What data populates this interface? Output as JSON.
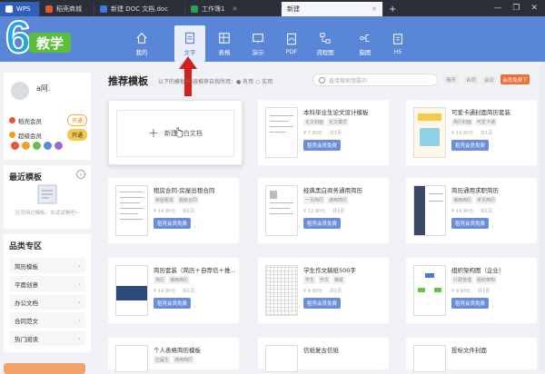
{
  "tabs": [
    {
      "label": "WPS",
      "color": "#2b6fd6"
    },
    {
      "label": "稻壳商城",
      "color": "#e8562f"
    },
    {
      "label": "新建 DOC 文档.doc",
      "color": "#3b7be0"
    },
    {
      "label": "工作簿1",
      "color": "#2ea04b"
    },
    {
      "label": "新建",
      "active": true
    }
  ],
  "window_controls": {
    "add": "+",
    "minimize": "—",
    "restore": "❐",
    "close": "✕"
  },
  "logo": {
    "digit": "6",
    "badge": "教学"
  },
  "categories": [
    {
      "label": "我的",
      "icon": "home-icon"
    },
    {
      "label": "文字",
      "icon": "doc-icon",
      "active": true
    },
    {
      "label": "表格",
      "icon": "sheet-icon"
    },
    {
      "label": "演示",
      "icon": "slide-icon"
    },
    {
      "label": "PDF",
      "icon": "pdf-icon"
    },
    {
      "label": "流程图",
      "icon": "flow-icon"
    },
    {
      "label": "脑图",
      "icon": "mind-icon"
    },
    {
      "label": "H5",
      "icon": "h5-icon"
    }
  ],
  "user": {
    "name": "a阿.",
    "rows": [
      {
        "label": "稻壳会员",
        "action": "开通",
        "color": "#e9553a",
        "filled": false
      },
      {
        "label": "超级会员",
        "action": "开通",
        "color": "#e8a317",
        "filled": true
      }
    ]
  },
  "recent": {
    "title": "最近模板",
    "empty_text": "还没用过模板，去试试看吧~"
  },
  "category_zone": {
    "title": "品类专区",
    "items": [
      "简历模板",
      "平面创意",
      "办公文档",
      "合同范文",
      "热门阅读"
    ]
  },
  "main": {
    "title": "推荐模板",
    "filter_text": "以下的模板/内容推荐自我所用：● 有用  ○ 实用",
    "search_placeholder": "直接搜索想要的",
    "tags": [
      "简历",
      "合同",
      "会议"
    ],
    "vip_button": "会员免费下",
    "new_blank": "新建空白文档"
  },
  "templates": [
    {
      "title": "本科毕业生论文设计模板",
      "tags": [
        "论文封面",
        "论文模式"
      ],
      "price": "¥ 7.90元",
      "pages": "共1页",
      "button": "稻壳会员免费"
    },
    {
      "title": "可爱卡通封面简历套装",
      "tags": [
        "简历封面",
        "可爱卡通"
      ],
      "price": "¥ 14.90元",
      "pages": "共1页",
      "button": "稻壳会员免费"
    },
    {
      "title": "租房合同-房屋出租合同",
      "tags": [
        "房屋租赁",
        "租房合同"
      ],
      "price": "¥ 14.90元",
      "pages": "共1页",
      "button": "稻壳会员免费"
    },
    {
      "title": "经典黑白商务通用简历",
      "tags": [
        "一页简历",
        "通用简历"
      ],
      "price": "¥ 12.90元",
      "pages": "共1页",
      "button": "稻壳会员免费"
    },
    {
      "title": "简历通用求职简历",
      "tags": [
        "通用简历",
        "单页简历"
      ],
      "price": "¥ 14.90元",
      "pages": "共1页",
      "button": "稻壳会员免费"
    },
    {
      "title": "简历套装（简历＋自荐信＋推...",
      "tags": [
        "简历",
        "通用简历"
      ],
      "price": "¥ 14.90元",
      "pages": "共1页",
      "button": "稻壳会员免费"
    },
    {
      "title": "学生作文稿纸500字",
      "tags": [
        "学生",
        "作文",
        "稿纸"
      ],
      "price": "¥ 4.90元",
      "pages": "共1页",
      "button": "稻壳会员免费"
    },
    {
      "title": "组织架构图（企业）",
      "tags": [
        "行政管理",
        "组织架构"
      ],
      "price": "¥ 9.90元",
      "pages": "共1页",
      "button": "稻壳会员免费"
    },
    {
      "title": "个人表格简历模板",
      "tags": [
        "应届生",
        "通用简历"
      ],
      "price": "",
      "pages": "",
      "button": ""
    },
    {
      "title": "信纸复古信纸",
      "tags": [],
      "price": "",
      "pages": "",
      "button": ""
    },
    {
      "title": "投标文件封面",
      "tags": [],
      "price": "",
      "pages": "",
      "button": ""
    }
  ]
}
